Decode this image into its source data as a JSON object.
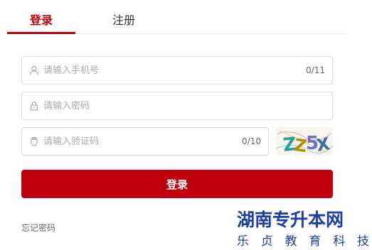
{
  "tabs": [
    {
      "label": "登录",
      "active": true
    },
    {
      "label": "注册",
      "active": false
    }
  ],
  "form": {
    "phone": {
      "placeholder": "请输入手机号",
      "value": "",
      "counter": "0/11",
      "icon": "user-icon"
    },
    "password": {
      "placeholder": "请输入密码",
      "value": "",
      "icon": "lock-icon"
    },
    "code": {
      "placeholder": "请输入验证码",
      "value": "",
      "counter": "0/10",
      "icon": "shield-icon"
    },
    "captcha_text": "ZZ5X",
    "submit_label": "登录",
    "forgot_label": "忘记密码"
  },
  "watermark": {
    "title": "湖南专升本网",
    "subtitle": [
      "乐",
      "贞",
      "教",
      "育",
      "科",
      "技"
    ]
  },
  "colors": {
    "accent": "#c1000e",
    "watermark": "#1a3fa0"
  }
}
